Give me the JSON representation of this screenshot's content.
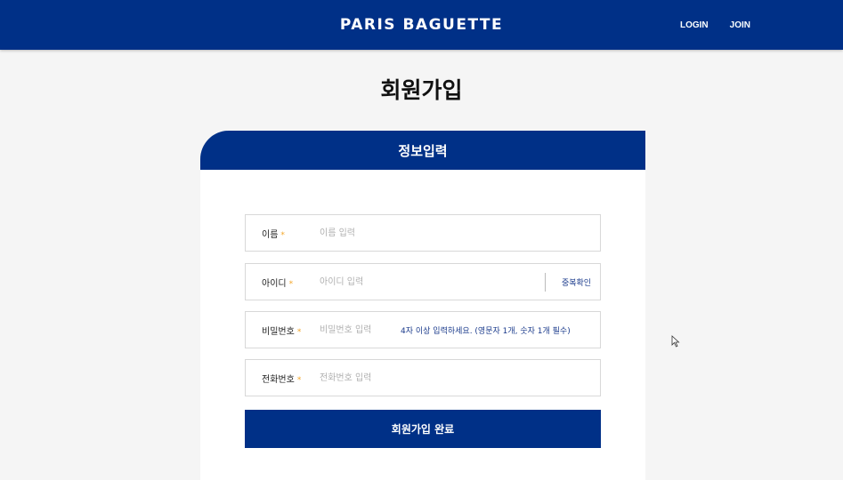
{
  "header": {
    "brand": "PARIS BAGUETTE",
    "nav": {
      "login": "LOGIN",
      "join": "JOIN"
    }
  },
  "page": {
    "title": "회원가입"
  },
  "form": {
    "section_title": "정보입력",
    "fields": {
      "name": {
        "label": "이름",
        "required_mark": "*",
        "placeholder": "이름 입력",
        "value": ""
      },
      "id": {
        "label": "아이디",
        "required_mark": "*",
        "placeholder": "아이디 입력",
        "value": "",
        "check_button": "중복확인"
      },
      "password": {
        "label": "비밀번호",
        "required_mark": "*",
        "placeholder": "비밀번호 입력",
        "value": "",
        "hint": "4자 이상 입력하세요. (영문자 1개, 숫자 1개 필수)"
      },
      "phone": {
        "label": "전화번호",
        "required_mark": "*",
        "placeholder": "전화번호 입력",
        "value": ""
      }
    },
    "submit_label": "회원가입 완료"
  },
  "colors": {
    "primary": "#003087",
    "required": "#f3a629",
    "hint": "#1b3b8c",
    "background": "#f5f5f5"
  },
  "icons": {
    "cursor": "mouse-pointer-icon"
  }
}
